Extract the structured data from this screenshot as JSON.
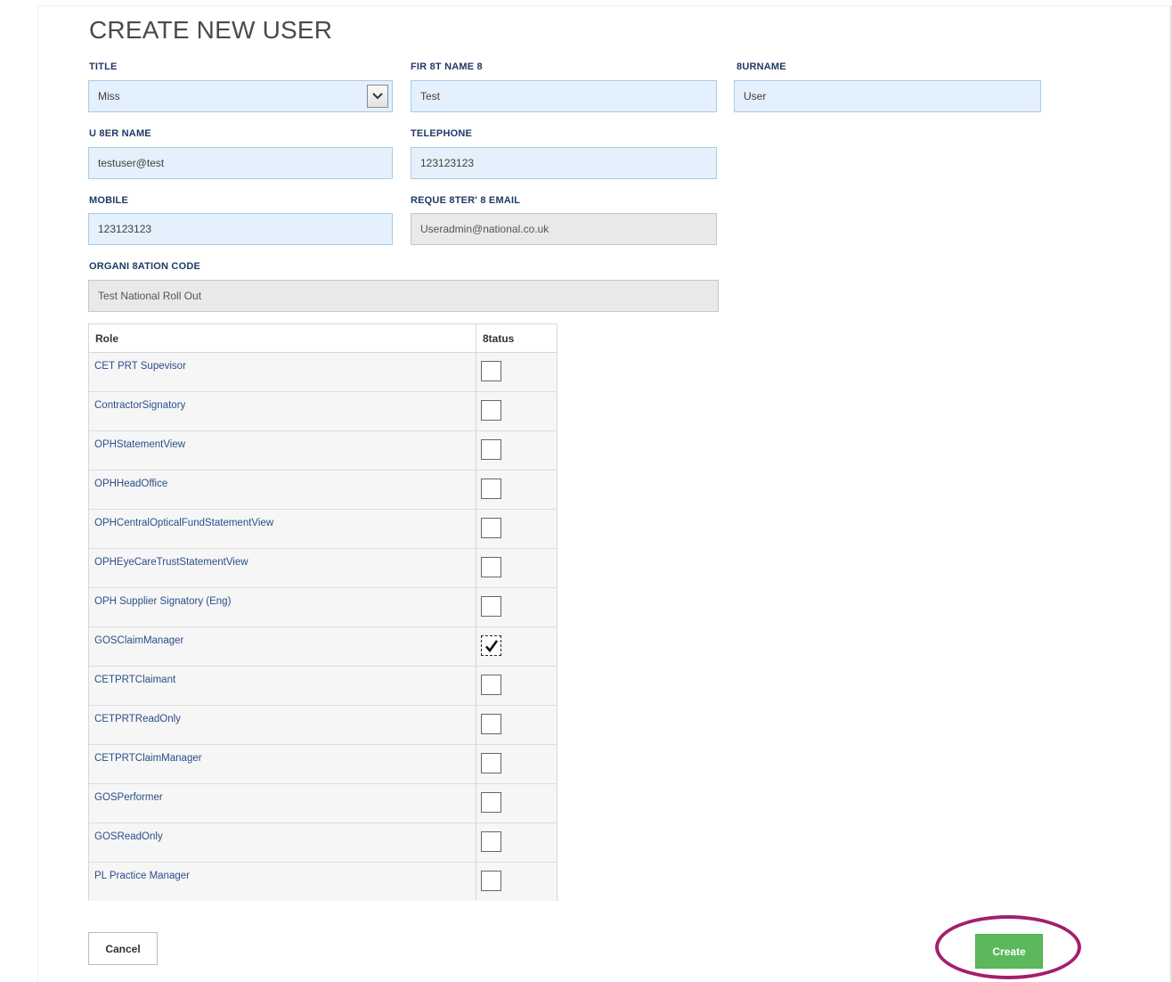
{
  "page": {
    "title": "CREATE NEW USER"
  },
  "form": {
    "title": {
      "label": "TITLE",
      "value": "Miss"
    },
    "first_name": {
      "label": "FIR 8T NAME 8",
      "value": "Test"
    },
    "surname": {
      "label": "8URNAME",
      "value": "User"
    },
    "user_name": {
      "label": "U 8ER NAME",
      "value": "testuser@test"
    },
    "telephone": {
      "label": "TELEPHONE",
      "value": "123123123"
    },
    "mobile": {
      "label": "MOBILE",
      "value": "123123123"
    },
    "requester_email": {
      "label": "REQUE 8TER' 8 EMAIL",
      "value": "Useradmin@national.co.uk"
    },
    "organisation_code": {
      "label": "ORGANI 8ATION CODE",
      "value": "Test National Roll Out"
    }
  },
  "roles": {
    "headers": {
      "role": "Role",
      "status": "8tatus"
    },
    "items": [
      {
        "name": "CET PRT Supevisor",
        "checked": false
      },
      {
        "name": "ContractorSignatory",
        "checked": false
      },
      {
        "name": "OPHStatementView",
        "checked": false
      },
      {
        "name": "OPHHeadOffice",
        "checked": false
      },
      {
        "name": "OPHCentralOpticalFundStatementView",
        "checked": false
      },
      {
        "name": "OPHEyeCareTrustStatementView",
        "checked": false
      },
      {
        "name": "OPH Supplier Signatory (Eng)",
        "checked": false
      },
      {
        "name": "GOSClaimManager",
        "checked": true
      },
      {
        "name": "CETPRTClaimant",
        "checked": false
      },
      {
        "name": "CETPRTReadOnly",
        "checked": false
      },
      {
        "name": "CETPRTClaimManager",
        "checked": false
      },
      {
        "name": "GOSPerformer",
        "checked": false
      },
      {
        "name": "GOSReadOnly",
        "checked": false
      },
      {
        "name": "PL Practice Manager",
        "checked": false
      }
    ]
  },
  "actions": {
    "cancel_label": "Cancel",
    "create_label": "Create"
  },
  "icons": {
    "dropdown": "chevron-down-icon",
    "check": "checkmark-icon"
  },
  "colors": {
    "label": "#1f3a66",
    "input_bg": "#e4f0fb",
    "create": "#5cb85c",
    "highlight": "#a3206a"
  }
}
